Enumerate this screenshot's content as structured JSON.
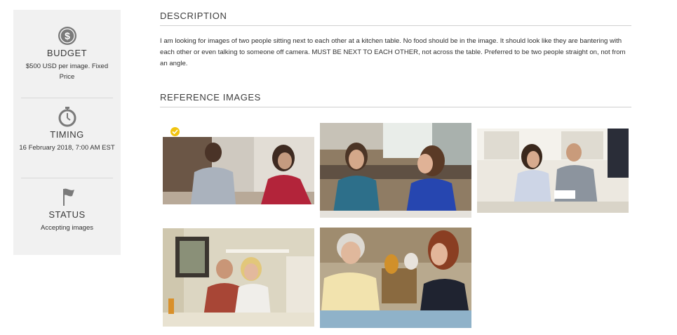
{
  "sidebar": {
    "budget": {
      "title": "BUDGET",
      "text": "$500 USD per image. Fixed Price",
      "icon": "dollar-icon"
    },
    "timing": {
      "title": "TIMING",
      "text": "16 February 2018, 7:00 AM EST",
      "icon": "stopwatch-icon"
    },
    "status": {
      "title": "STATUS",
      "text": "Accepting images",
      "icon": "flag-icon"
    }
  },
  "description": {
    "heading": "DESCRIPTION",
    "text": "I am looking for images of two people sitting next to each other at a kitchen table. No food should be in the image. It should look like they are bantering with each other or even talking to someone off camera. MUST BE NEXT TO EACH OTHER, not across the table. Preferred to be two people straight on, not from an angle."
  },
  "reference": {
    "heading": "REFERENCE IMAGES",
    "selected_badge": "check-icon"
  },
  "colors": {
    "sidebar_bg": "#f1f1f1",
    "icon_gray": "#7a7a7a",
    "badge_yellow": "#f1c40f"
  }
}
